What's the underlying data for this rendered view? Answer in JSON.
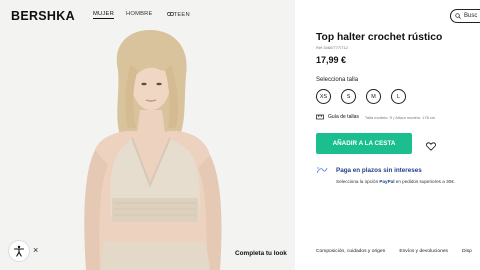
{
  "brand": {
    "logo": "BERSHKA"
  },
  "nav": {
    "mujer": "MUJER",
    "hombre": "HOMBRE",
    "teen": "TEEN"
  },
  "search": {
    "label": "Busc"
  },
  "product": {
    "title": "Top halter crochet rústico",
    "ref": "Ref 3460/777/712",
    "price": "17,99 €",
    "size_label": "Selecciona talla",
    "sizes": [
      "XS",
      "S",
      "M",
      "L"
    ],
    "guide_label": "Guía de tallas",
    "guide_model": "Talla modelo: S | Altura modelo: 178 cm",
    "cart_button": "AÑADIR A LA CESTA",
    "plazos": "Paga en plazos sin intereses",
    "paypal_prefix": "Selecciona la opción ",
    "paypal_brand": "PayPal",
    "paypal_suffix": " en pedidos superiores a 30€."
  },
  "image_overlay": {
    "close": "×",
    "complete_look": "Completa tu look"
  },
  "footer": {
    "links": [
      "Composición, cuidados y origen",
      "Envíos y devoluciones",
      "Disp"
    ]
  },
  "colors": {
    "accent": "#1bbf8f",
    "paypal": "#1e3f8a",
    "image_bg": "#f3f3f1"
  }
}
